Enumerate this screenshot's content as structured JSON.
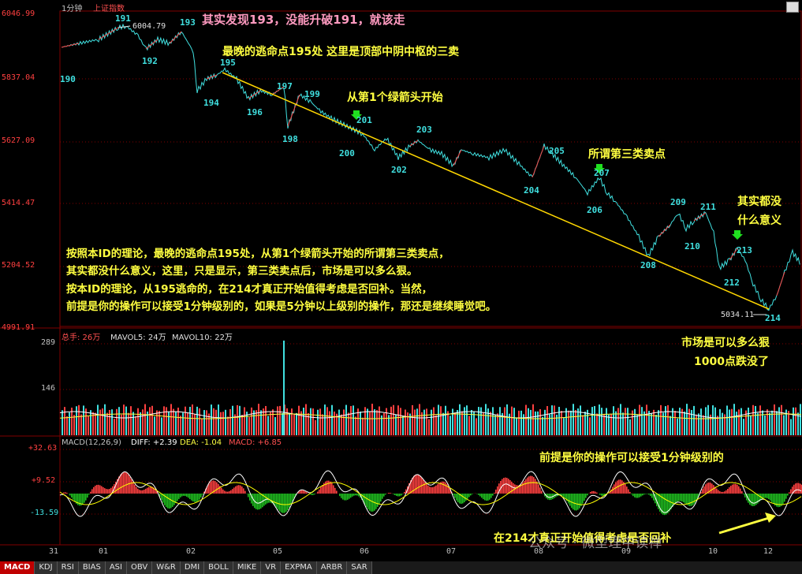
{
  "header": {
    "period": "1分钟",
    "index_name": "上证指数",
    "vol_label": "总手: 26万",
    "mavol5": "MAVOL5: 24万",
    "mavol10": "MAVOL10: 22万",
    "macd_title": "MACD(12,26,9)",
    "diff": "DIFF: +2.39",
    "dea": "DEA: -1.04",
    "macd_val": "MACD: +6.85"
  },
  "price_axis": [
    "6046.99",
    "5837.04",
    "5627.09",
    "5414.47",
    "5204.52",
    "4991.91"
  ],
  "vol_axis": [
    "289",
    "146"
  ],
  "macd_axis": [
    "+32.63",
    "+9.52",
    "-13.59"
  ],
  "x_ticks": [
    "31",
    "01",
    "02",
    "05",
    "06",
    "07",
    "08",
    "09",
    "10",
    "12"
  ],
  "price_labels": {
    "high": "6004.79",
    "low": "5034.11"
  },
  "waves": [
    "190",
    "191",
    "192",
    "193",
    "194",
    "195",
    "196",
    "197",
    "198",
    "199",
    "200",
    "201",
    "202",
    "203",
    "204",
    "205",
    "206",
    "207",
    "208",
    "209",
    "210",
    "211",
    "212",
    "213",
    "214"
  ],
  "notes": {
    "n1": "其实发现193，没能升破191，就该走",
    "n2": "最晚的逃命点195处 这里是顶部中阴中枢的三卖",
    "n3": "从第1个绿箭头开始",
    "n4": "所谓第三类卖点",
    "n5a": "其实都没",
    "n5b": "什么意义",
    "p1": "按照本ID的理论，最晚的逃命点195处，从第1个绿箭头开始的所谓第三类卖点，",
    "p2": "其实都没什么意义，这里，只是显示，第三类卖点后，市场是可以多么狠。",
    "p3": "按本ID的理论，从195逃命的，在214才真正开始值得考虑是否回补。当然，",
    "p4": "前提是你的操作可以接受1分钟级别的，如果是5分钟以上级别的操作，那还是继续睡觉吧。",
    "m1": "市场是可以多么狠",
    "m2": "1000点跌没了",
    "b1": "前提是你的操作可以接受1分钟级别的",
    "b2": "在214才真正开始值得考虑是否回补"
  },
  "tabs": [
    "MACD",
    "KDJ",
    "RSI",
    "BIAS",
    "ASI",
    "OBV",
    "W&R",
    "DMI",
    "BOLL",
    "MIKE",
    "VR",
    "EXPMA",
    "ARBR",
    "SAR"
  ],
  "watermark": "公众号 · 微型理中读禅",
  "colors": {
    "up": "#ff4040",
    "down": "#40e0e0",
    "trend": "#ffd700",
    "grid": "#800000",
    "diff": "#ffffff",
    "dea": "#ffff00"
  }
}
